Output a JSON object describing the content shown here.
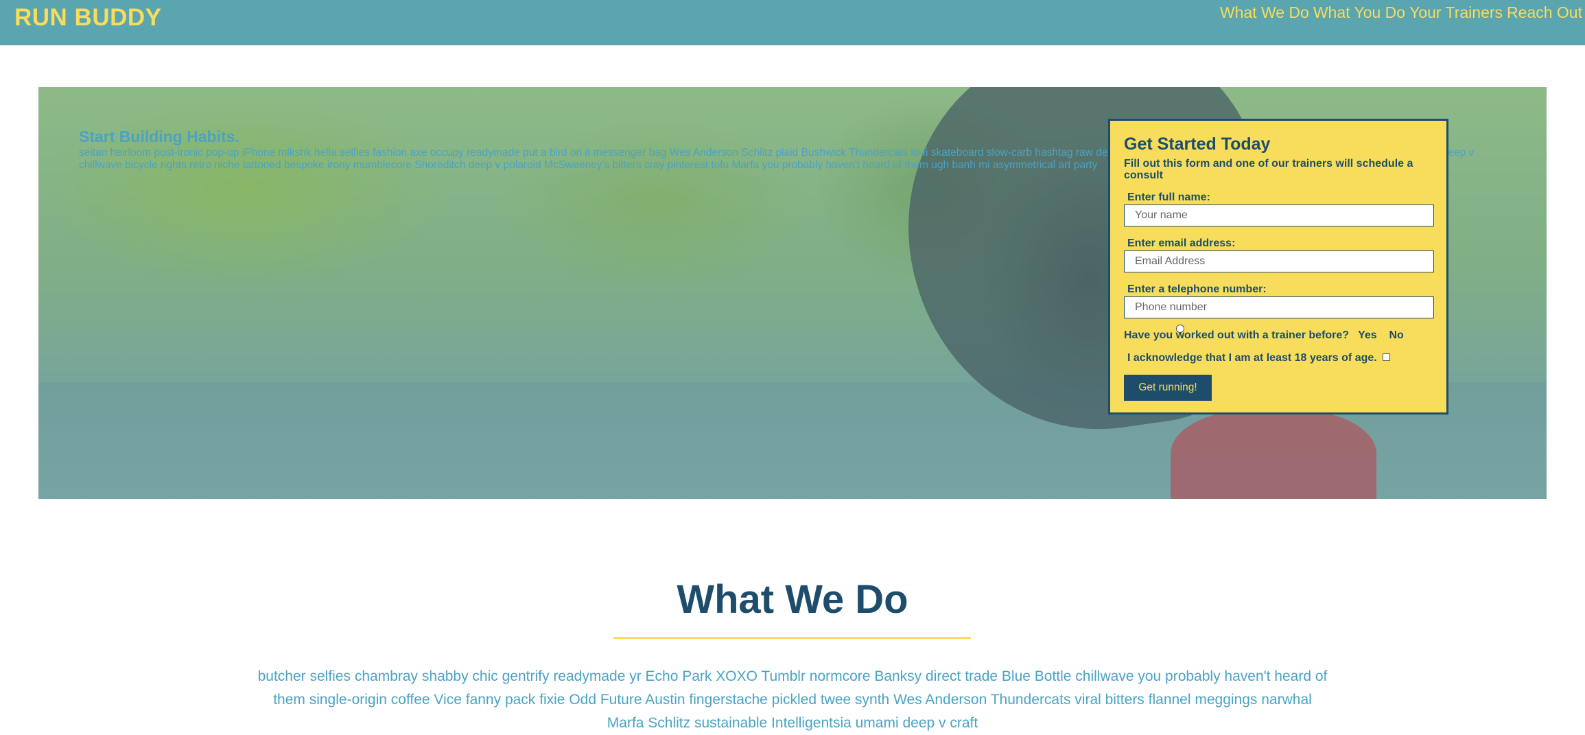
{
  "header": {
    "logo": "RUN BUDDY",
    "nav": [
      "What We Do",
      "What You Do",
      "Your Trainers",
      "Reach Out"
    ]
  },
  "hero": {
    "title": "Start Building Habits.",
    "text": "seitan heirloom post-ironic pop-up iPhone mlkshk hella selfies fashion axe occupy readymade put a bird on it messenger bag Wes Anderson Schlitz plaid Bushwick Thundercats lo-fi skateboard slow-carb hashtag raw denim gluten-free chia keffiyeh XOXO Austin fingerstache typewriter cray deep v chillwave bicycle rights retro niche tattooed bespoke irony mumblecore Shoreditch deep v polaroid McSweeney's bitters cray pinterest tofu Marfa you probably haven't heard of them ugh banh mi asymmetrical art party"
  },
  "form": {
    "title": "Get Started Today",
    "subtitle": "Fill out this form and one of our trainers will schedule a consult",
    "name_label": "Enter full name:",
    "name_placeholder": "Your name",
    "email_label": "Enter email address:",
    "email_placeholder": "Email Address",
    "phone_label": "Enter a telephone number:",
    "phone_placeholder": "Phone number",
    "trainer_question": "Have you worked out with a trainer before?",
    "yes": "Yes",
    "no": "No",
    "acknowledge": "I acknowledge that I am at least 18 years of age.",
    "submit": "Get running!"
  },
  "what_we_do": {
    "title": "What We Do",
    "text": "butcher selfies chambray shabby chic gentrify readymade yr Echo Park XOXO Tumblr normcore Banksy direct trade Blue Bottle chillwave you probably haven't heard of them single-origin coffee Vice fanny pack fixie Odd Future Austin fingerstache pickled twee synth Wes Anderson Thundercats viral bitters flannel meggings narwhal Marfa Schlitz sustainable Intelligentsia umami deep v craft"
  },
  "colors": {
    "header_bg": "#5ba5b0",
    "accent_yellow": "#f7dd5b",
    "navy": "#1e4d6b",
    "teal_text": "#4aa3c4"
  }
}
